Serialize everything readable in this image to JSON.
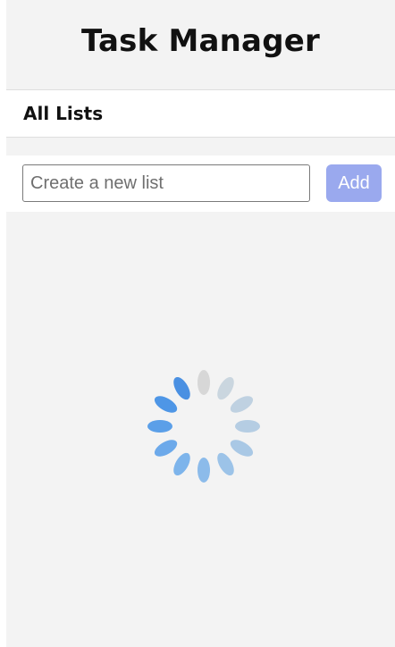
{
  "header": {
    "title": "Task Manager"
  },
  "section": {
    "title": "All Lists"
  },
  "create_list": {
    "placeholder": "Create a new list",
    "value": "",
    "add_label": "Add"
  },
  "colors": {
    "background": "#f3f3f3",
    "panel": "#ffffff",
    "add_button": "#9aa9ee",
    "spinner_active": "#4a90e2",
    "spinner_inactive": "#d8d8d8"
  },
  "loading_indicator": {
    "icon": "loading-spinner-icon",
    "segments": 12
  }
}
